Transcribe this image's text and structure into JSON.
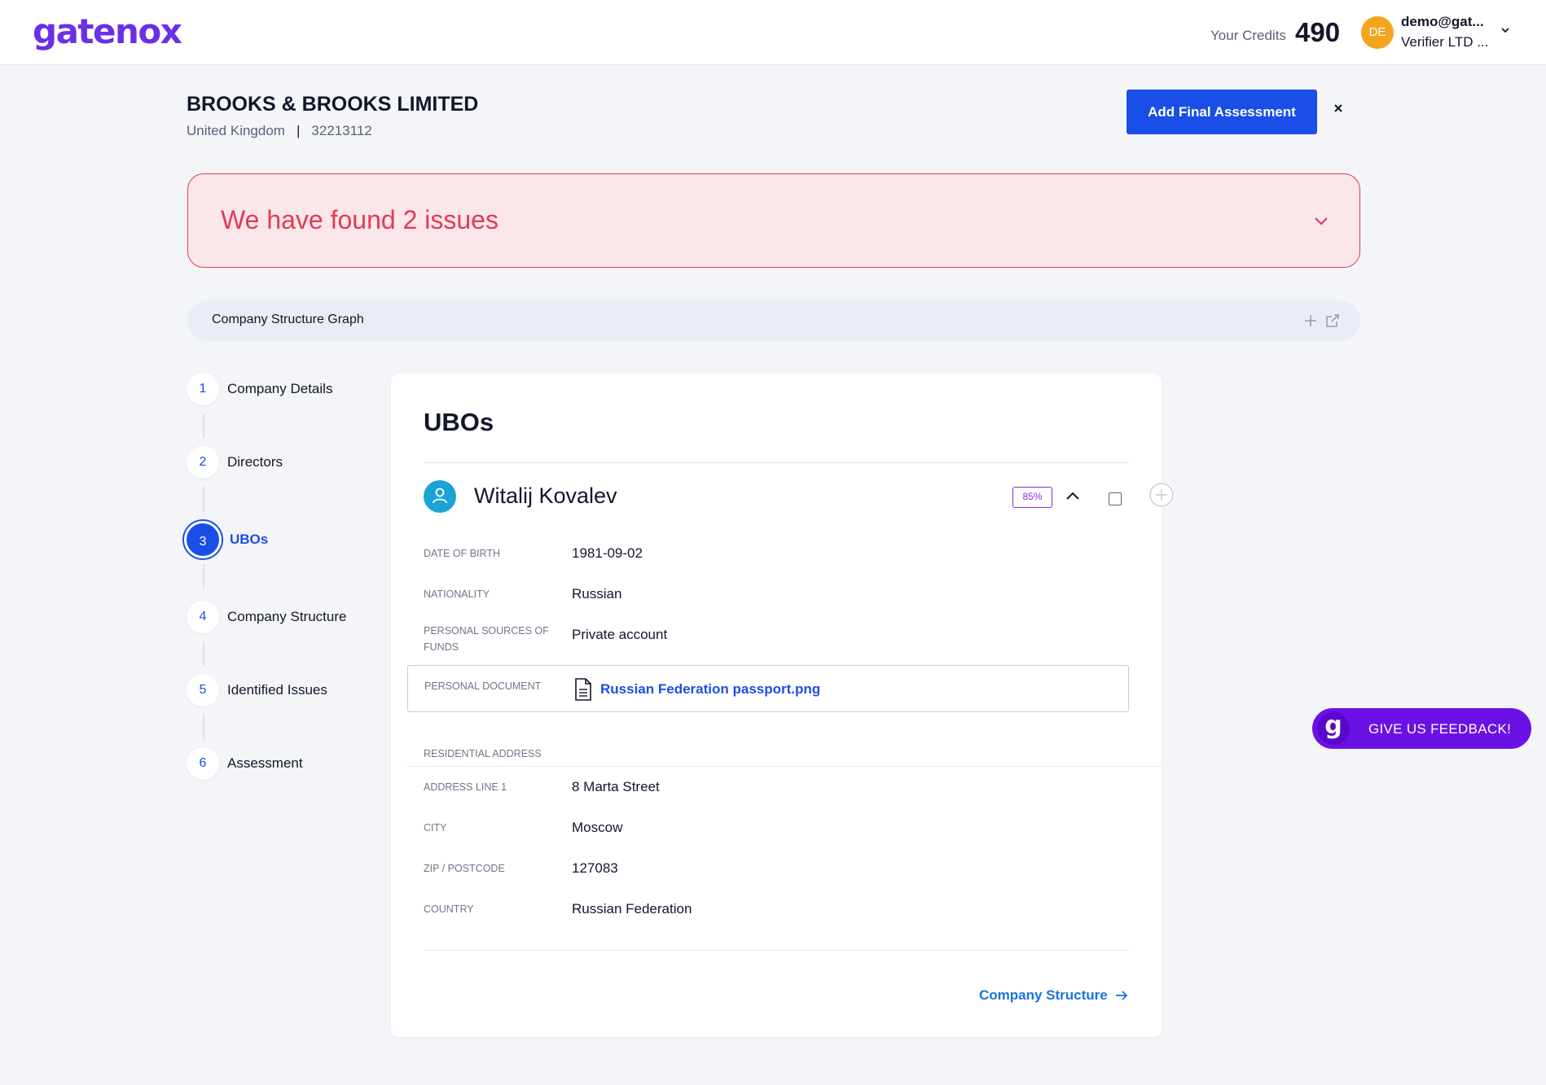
{
  "header": {
    "logo_text": "gatenox",
    "credits_label": "Your Credits",
    "credits_value": "490",
    "avatar_initials": "DE",
    "user_email": "demo@gat...",
    "user_org": "Verifier LTD ..."
  },
  "company": {
    "name": "BROOKS & BROOKS LIMITED",
    "country": "United Kingdom",
    "number": "32213112",
    "final_assessment_label": "Add Final Assessment"
  },
  "issues": {
    "text": "We have found 2 issues",
    "accent_color": "#e23b58"
  },
  "graph": {
    "title": "Company Structure Graph"
  },
  "steps": [
    {
      "num": "1",
      "label": "Company Details"
    },
    {
      "num": "2",
      "label": "Directors"
    },
    {
      "num": "3",
      "label": "UBOs"
    },
    {
      "num": "4",
      "label": "Company Structure"
    },
    {
      "num": "5",
      "label": "Identified Issues"
    },
    {
      "num": "6",
      "label": "Assessment"
    }
  ],
  "active_step": "3",
  "card": {
    "title": "UBOs",
    "person": {
      "name": "Witalij Kovalev",
      "match_percent": "85%",
      "icon": "person-icon"
    },
    "fields": {
      "dob_label": "DATE OF BIRTH",
      "dob_value": "1981-09-02",
      "nationality_label": "NATIONALITY",
      "nationality_value": "Russian",
      "funds_label": "PERSONAL SOURCES OF FUNDS",
      "funds_value": "Private account",
      "document_label": "PERSONAL DOCUMENT",
      "document_value": "Russian Federation passport.png",
      "residential_label": "RESIDENTIAL ADDRESS",
      "address1_label": "ADDRESS LINE 1",
      "address1_value": "8 Marta Street",
      "city_label": "CITY",
      "city_value": "Moscow",
      "zip_label": "ZIP / POSTCODE",
      "zip_value": "127083",
      "country_label": "COUNTRY",
      "country_value": "Russian Federation"
    },
    "next_label": "Company Structure"
  },
  "feedback": {
    "logo_letter": "g",
    "label": "GIVE US FEEDBACK!"
  },
  "colors": {
    "brand": "#6b2fe6",
    "primary_button": "#1a4ee8",
    "feedback": "#6b11e6"
  }
}
